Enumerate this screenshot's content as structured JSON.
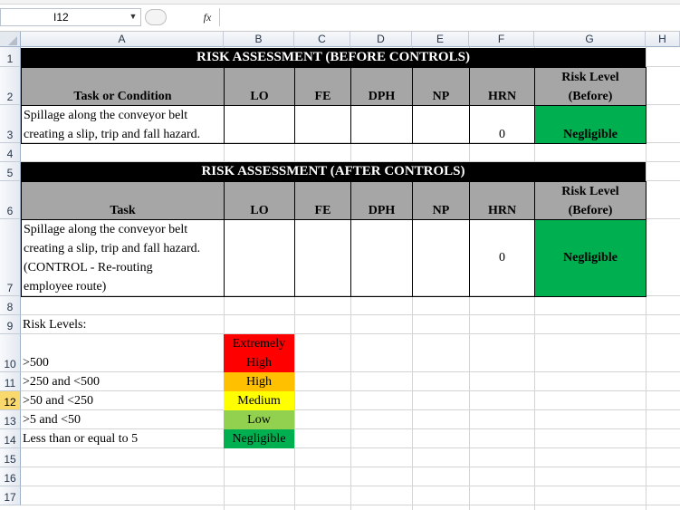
{
  "formula_bar": {
    "name_box": "I12",
    "dropdown_icon": "▼",
    "fx_label": "fx",
    "formula": ""
  },
  "columns": [
    "A",
    "B",
    "C",
    "D",
    "E",
    "F",
    "G",
    "H"
  ],
  "rows": [
    "1",
    "2",
    "3",
    "4",
    "5",
    "6",
    "7",
    "8",
    "9",
    "10",
    "11",
    "12",
    "13",
    "14",
    "15",
    "16",
    "17"
  ],
  "table1": {
    "title": "RISK ASSESSMENT (BEFORE CONTROLS)",
    "headers": {
      "task": "Task or Condition",
      "lo": "LO",
      "fe": "FE",
      "dph": "DPH",
      "np": "NP",
      "hrn": "HRN",
      "risk_line1": "Risk Level",
      "risk_line2": "(Before)"
    },
    "row": {
      "task_line1": "Spillage along the conveyor belt",
      "task_line2": "creating a slip, trip and fall hazard.",
      "hrn": "0",
      "risk": "Negligible"
    }
  },
  "table2": {
    "title": "RISK ASSESSMENT (AFTER CONTROLS)",
    "headers": {
      "task": "Task",
      "lo": "LO",
      "fe": "FE",
      "dph": "DPH",
      "np": "NP",
      "hrn": "HRN",
      "risk_line1": "Risk Level",
      "risk_line2": "(Before)"
    },
    "row": {
      "task_line1": "Spillage along the conveyor belt",
      "task_line2": "creating a slip, trip and fall hazard.",
      "task_line3": "(CONTROL - Re-routing",
      "task_line4": "employee route)",
      "hrn": "0",
      "risk": "Negligible"
    }
  },
  "risk_levels": {
    "title": "Risk Levels:",
    "items": [
      {
        "range": ">500",
        "label_line1": "Extremely",
        "label_line2": "High",
        "color": "#ff0000"
      },
      {
        "range": ">250 and <500",
        "label_line1": "High",
        "color": "#ffc000"
      },
      {
        "range": ">50 and <250",
        "label_line1": "Medium",
        "color": "#ffff00"
      },
      {
        "range": ">5 and <50",
        "label_line1": "Low",
        "color": "#92d050"
      },
      {
        "range": "Less than or equal to 5",
        "label_line1": "Negligible",
        "color": "#00b050"
      }
    ]
  },
  "colors": {
    "black_band": "#000000",
    "header_gray": "#a6a6a6",
    "negligible_green": "#00b050",
    "active_row_header": "#f9d86d"
  }
}
